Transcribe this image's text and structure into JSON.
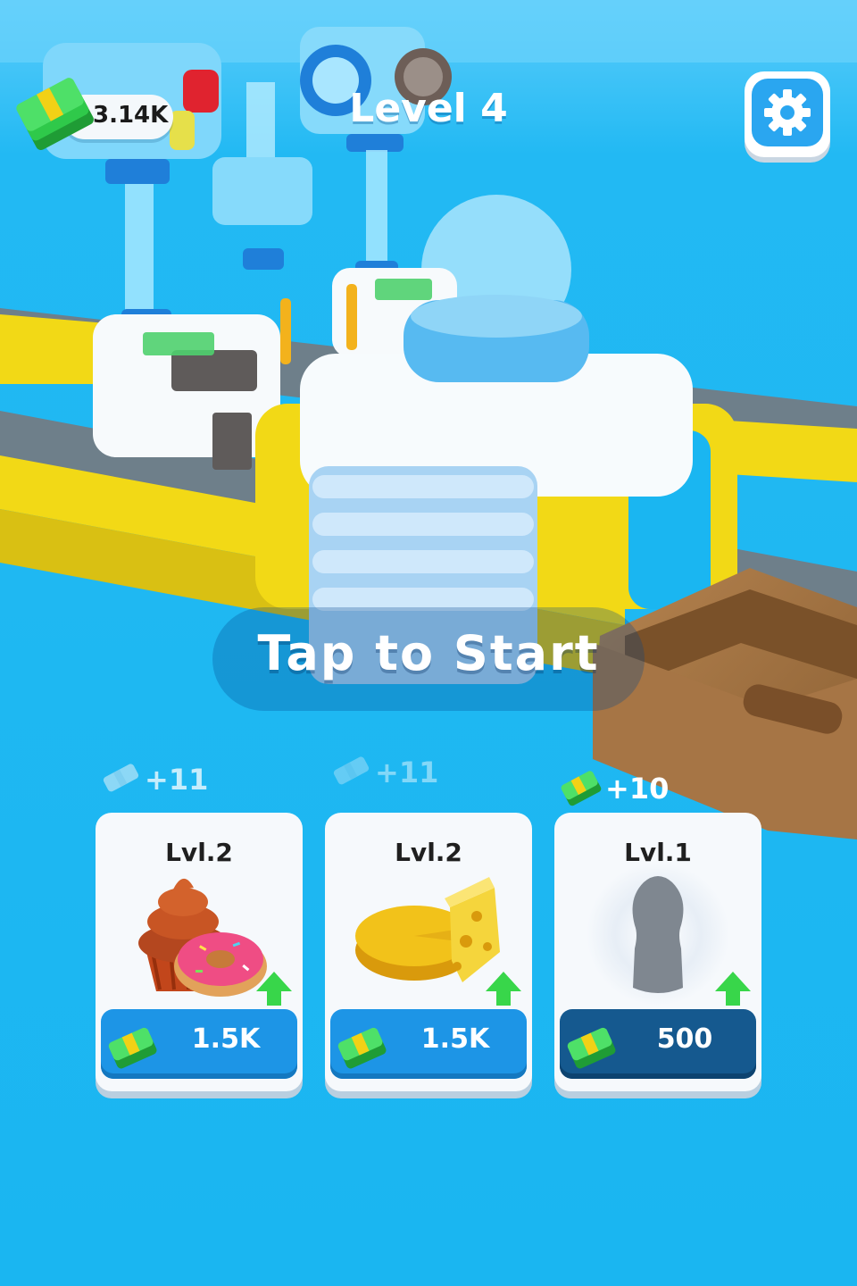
{
  "hud": {
    "money": "3.14K",
    "level_title": "Level 4",
    "settings_icon": "gear-icon"
  },
  "prompt": {
    "tap_to_start": "Tap to Start"
  },
  "upgrades": [
    {
      "earn": "+11",
      "level": "Lvl.2",
      "price": "1.5K",
      "item": "cupcake-and-donut",
      "state": "owned"
    },
    {
      "earn": "+11",
      "level": "Lvl.2",
      "price": "1.5K",
      "item": "cheese",
      "state": "owned"
    },
    {
      "earn": "+10",
      "level": "Lvl.1",
      "price": "500",
      "item": "locked-silhouette",
      "state": "locked"
    }
  ],
  "colors": {
    "background": "#1fb8f2",
    "belt_rail": "#f4dd1c",
    "button_blue": "#1d95e6",
    "button_locked": "#15598f",
    "upgrade_arrow": "#38d64a",
    "cash_green": "#2fc94a"
  }
}
